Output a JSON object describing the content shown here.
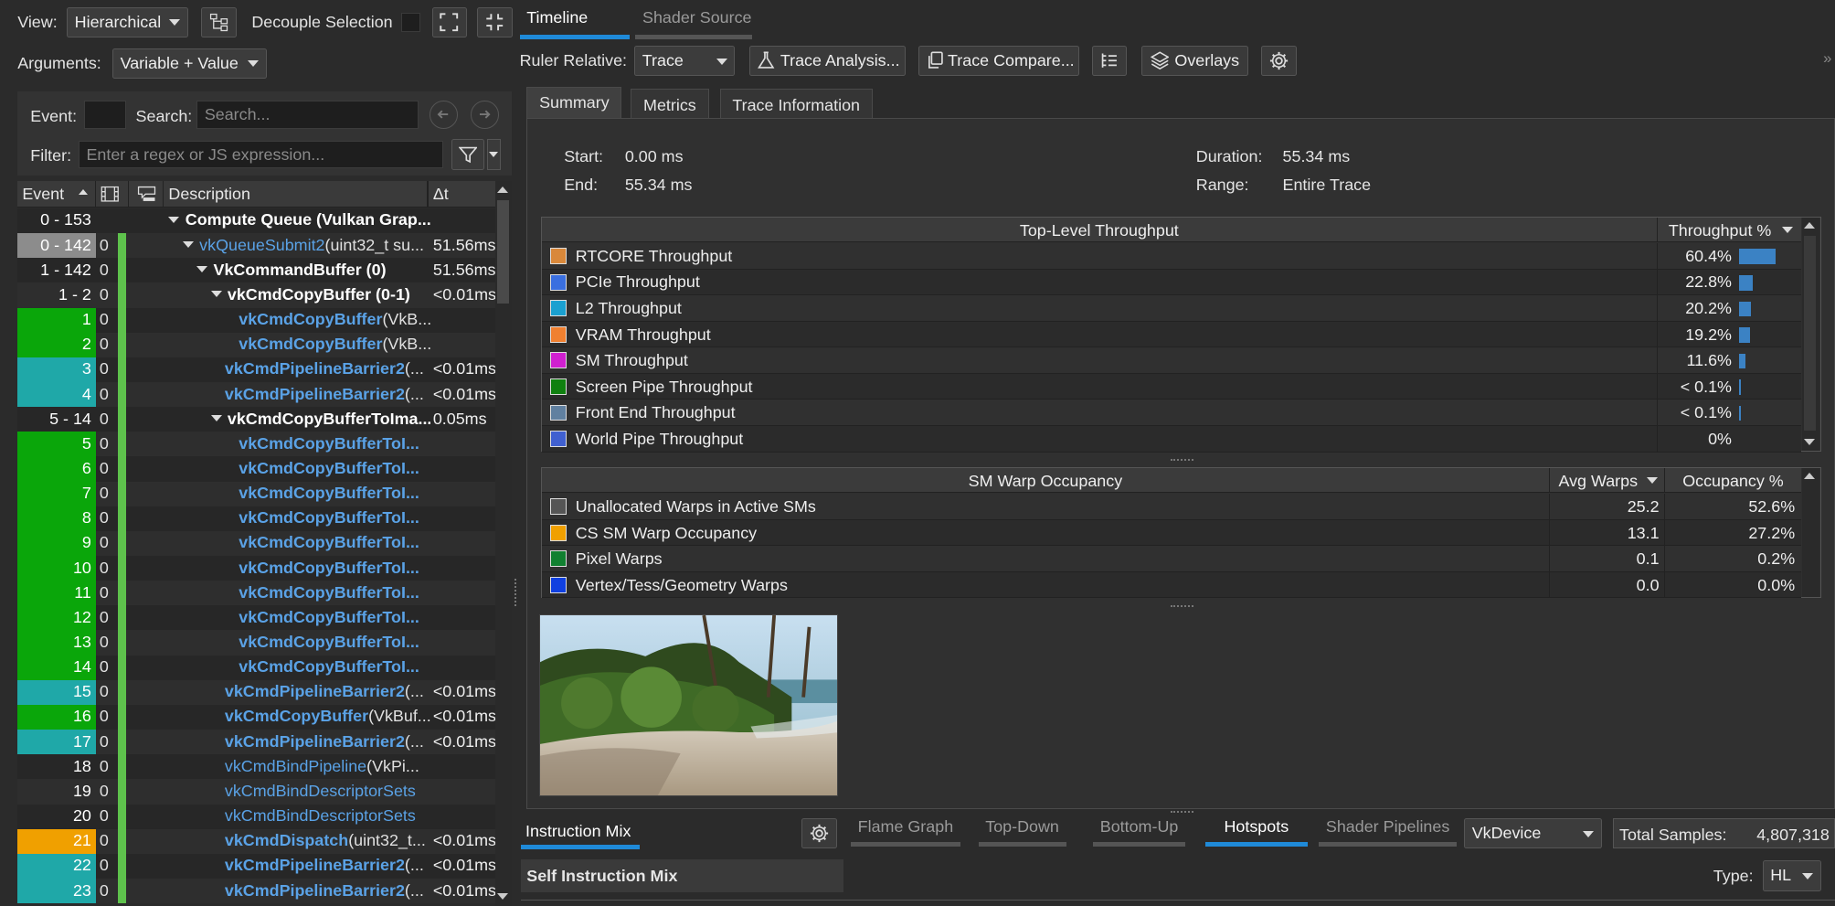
{
  "toolbar": {
    "view_label": "View:",
    "view_value": "Hierarchical",
    "decouple_label": "Decouple Selection",
    "arguments_label": "Arguments:",
    "arguments_value": "Variable + Value"
  },
  "search": {
    "event_label": "Event:",
    "search_label": "Search:",
    "search_placeholder": "Search...",
    "filter_label": "Filter:",
    "filter_placeholder": "Enter a regex or JS expression..."
  },
  "tree": {
    "headers": {
      "event": "Event",
      "description": "Description",
      "delta": "Δt"
    },
    "rows": [
      {
        "event": "0 - 153",
        "zero": "",
        "name": "Compute Queue (Vulkan Grap...",
        "args": "",
        "dt": "",
        "indent": 0,
        "style": "bold",
        "tri": true,
        "color": "",
        "bar": false
      },
      {
        "event": "0 - 142",
        "zero": "0",
        "name": "vkQueueSubmit2",
        "args": "(uint32_t su...",
        "dt": "51.56ms",
        "indent": 1,
        "style": "fnl",
        "tri": true,
        "color": "#8c8c8c",
        "bar": true
      },
      {
        "event": "1 - 142",
        "zero": "0",
        "name": "VkCommandBuffer (0)",
        "args": "",
        "dt": "51.56ms",
        "indent": 2,
        "style": "bold",
        "tri": true,
        "color": "",
        "bar": true
      },
      {
        "event": "1 - 2",
        "zero": "0",
        "name": "vkCmdCopyBuffer (0-1)",
        "args": "",
        "dt": "<0.01ms",
        "indent": 3,
        "style": "bold",
        "tri": true,
        "color": "",
        "bar": true
      },
      {
        "event": "1",
        "zero": "0",
        "name": "vkCmdCopyBuffer",
        "args": "(VkB...",
        "dt": "",
        "indent": 4,
        "style": "fn",
        "tri": false,
        "color": "#0aa60a",
        "bar": true
      },
      {
        "event": "2",
        "zero": "0",
        "name": "vkCmdCopyBuffer",
        "args": "(VkB...",
        "dt": "",
        "indent": 4,
        "style": "fn",
        "tri": false,
        "color": "#0aa60a",
        "bar": true
      },
      {
        "event": "3",
        "zero": "0",
        "name": "vkCmdPipelineBarrier2",
        "args": "(...",
        "dt": "<0.01ms",
        "indent": 3,
        "style": "fn",
        "tri": false,
        "color": "#1fa8a8",
        "bar": true
      },
      {
        "event": "4",
        "zero": "0",
        "name": "vkCmdPipelineBarrier2",
        "args": "(...",
        "dt": "<0.01ms",
        "indent": 3,
        "style": "fn",
        "tri": false,
        "color": "#1fa8a8",
        "bar": true
      },
      {
        "event": "5 - 14",
        "zero": "0",
        "name": "vkCmdCopyBufferToIma...",
        "args": "",
        "dt": "0.05ms",
        "indent": 3,
        "style": "bold",
        "tri": true,
        "color": "",
        "bar": true
      },
      {
        "event": "5",
        "zero": "0",
        "name": "vkCmdCopyBufferToI...",
        "args": "",
        "dt": "",
        "indent": 4,
        "style": "fn",
        "tri": false,
        "color": "#0aa60a",
        "bar": true
      },
      {
        "event": "6",
        "zero": "0",
        "name": "vkCmdCopyBufferToI...",
        "args": "",
        "dt": "",
        "indent": 4,
        "style": "fn",
        "tri": false,
        "color": "#0aa60a",
        "bar": true
      },
      {
        "event": "7",
        "zero": "0",
        "name": "vkCmdCopyBufferToI...",
        "args": "",
        "dt": "",
        "indent": 4,
        "style": "fn",
        "tri": false,
        "color": "#0aa60a",
        "bar": true
      },
      {
        "event": "8",
        "zero": "0",
        "name": "vkCmdCopyBufferToI...",
        "args": "",
        "dt": "",
        "indent": 4,
        "style": "fn",
        "tri": false,
        "color": "#0aa60a",
        "bar": true
      },
      {
        "event": "9",
        "zero": "0",
        "name": "vkCmdCopyBufferToI...",
        "args": "",
        "dt": "",
        "indent": 4,
        "style": "fn",
        "tri": false,
        "color": "#0aa60a",
        "bar": true
      },
      {
        "event": "10",
        "zero": "0",
        "name": "vkCmdCopyBufferToI...",
        "args": "",
        "dt": "",
        "indent": 4,
        "style": "fn",
        "tri": false,
        "color": "#0aa60a",
        "bar": true
      },
      {
        "event": "11",
        "zero": "0",
        "name": "vkCmdCopyBufferToI...",
        "args": "",
        "dt": "",
        "indent": 4,
        "style": "fn",
        "tri": false,
        "color": "#0aa60a",
        "bar": true
      },
      {
        "event": "12",
        "zero": "0",
        "name": "vkCmdCopyBufferToI...",
        "args": "",
        "dt": "",
        "indent": 4,
        "style": "fn",
        "tri": false,
        "color": "#0aa60a",
        "bar": true
      },
      {
        "event": "13",
        "zero": "0",
        "name": "vkCmdCopyBufferToI...",
        "args": "",
        "dt": "",
        "indent": 4,
        "style": "fn",
        "tri": false,
        "color": "#0aa60a",
        "bar": true
      },
      {
        "event": "14",
        "zero": "0",
        "name": "vkCmdCopyBufferToI...",
        "args": "",
        "dt": "",
        "indent": 4,
        "style": "fn",
        "tri": false,
        "color": "#0aa60a",
        "bar": true
      },
      {
        "event": "15",
        "zero": "0",
        "name": "vkCmdPipelineBarrier2",
        "args": "(...",
        "dt": "<0.01ms",
        "indent": 3,
        "style": "fn",
        "tri": false,
        "color": "#1fa8a8",
        "bar": true
      },
      {
        "event": "16",
        "zero": "0",
        "name": "vkCmdCopyBuffer",
        "args": "(VkBuf...",
        "dt": "<0.01ms",
        "indent": 3,
        "style": "fn",
        "tri": false,
        "color": "#0aa60a",
        "bar": true
      },
      {
        "event": "17",
        "zero": "0",
        "name": "vkCmdPipelineBarrier2",
        "args": "(...",
        "dt": "<0.01ms",
        "indent": 3,
        "style": "fn",
        "tri": false,
        "color": "#1fa8a8",
        "bar": true
      },
      {
        "event": "18",
        "zero": "0",
        "name": "vkCmdBindPipeline",
        "args": "(VkPi...",
        "dt": "",
        "indent": 3,
        "style": "fnl",
        "tri": false,
        "color": "",
        "bar": true
      },
      {
        "event": "19",
        "zero": "0",
        "name": "vkCmdBindDescriptorSets",
        "args": "",
        "dt": "",
        "indent": 3,
        "style": "fnl",
        "tri": false,
        "color": "",
        "bar": true
      },
      {
        "event": "20",
        "zero": "0",
        "name": "vkCmdBindDescriptorSets",
        "args": "",
        "dt": "",
        "indent": 3,
        "style": "fnl",
        "tri": false,
        "color": "",
        "bar": true
      },
      {
        "event": "21",
        "zero": "0",
        "name": "vkCmdDispatch",
        "args": "(uint32_t...",
        "dt": "<0.01ms",
        "indent": 3,
        "style": "fn",
        "tri": false,
        "color": "#f0a000",
        "bar": true
      },
      {
        "event": "22",
        "zero": "0",
        "name": "vkCmdPipelineBarrier2",
        "args": "(...",
        "dt": "<0.01ms",
        "indent": 3,
        "style": "fn",
        "tri": false,
        "color": "#1fa8a8",
        "bar": true
      },
      {
        "event": "23",
        "zero": "0",
        "name": "vkCmdPipelineBarrier2",
        "args": "(...",
        "dt": "<0.01ms",
        "indent": 3,
        "style": "fn",
        "tri": false,
        "color": "#1fa8a8",
        "bar": true
      }
    ]
  },
  "top_tabs": {
    "timeline": "Timeline",
    "shader_source": "Shader Source"
  },
  "ruler": {
    "label": "Ruler Relative:",
    "value": "Trace",
    "trace_analysis": "Trace Analysis...",
    "trace_compare": "Trace Compare...",
    "overlays": "Overlays"
  },
  "panel_tabs": {
    "summary": "Summary",
    "metrics": "Metrics",
    "trace_info": "Trace Information"
  },
  "summary": {
    "start_label": "Start:",
    "start_value": "0.00 ms",
    "end_label": "End:",
    "end_value": "55.34 ms",
    "duration_label": "Duration:",
    "duration_value": "55.34 ms",
    "range_label": "Range:",
    "range_value": "Entire Trace"
  },
  "throughput": {
    "header": "Top-Level Throughput",
    "value_header": "Throughput %",
    "rows": [
      {
        "name": "RTCORE Throughput",
        "value": "60.4%",
        "pct": 60.4,
        "color": "#d9883a"
      },
      {
        "name": "PCIe Throughput",
        "value": "22.8%",
        "pct": 22.8,
        "color": "#3a6fe0"
      },
      {
        "name": "L2 Throughput",
        "value": "20.2%",
        "pct": 20.2,
        "color": "#1aa0d0"
      },
      {
        "name": "VRAM Throughput",
        "value": "19.2%",
        "pct": 19.2,
        "color": "#f08030"
      },
      {
        "name": "SM Throughput",
        "value": "11.6%",
        "pct": 11.6,
        "color": "#d020d0"
      },
      {
        "name": "Screen Pipe Throughput",
        "value": "< 0.1%",
        "pct": 0.1,
        "color": "#108010"
      },
      {
        "name": "Front End Throughput",
        "value": "< 0.1%",
        "pct": 0.1,
        "color": "#6080a0"
      },
      {
        "name": "World Pipe Throughput",
        "value": "0%",
        "pct": 0,
        "color": "#4060d0"
      }
    ]
  },
  "warps": {
    "header": "SM Warp Occupancy",
    "avg_header": "Avg Warps",
    "occ_header": "Occupancy %",
    "rows": [
      {
        "name": "Unallocated Warps in Active SMs",
        "avg": "25.2",
        "occ": "52.6%",
        "color": "#555555"
      },
      {
        "name": "CS SM Warp Occupancy",
        "avg": "13.1",
        "occ": "27.2%",
        "color": "#f0a000"
      },
      {
        "name": "Pixel Warps",
        "avg": "0.1",
        "occ": "0.2%",
        "color": "#108030"
      },
      {
        "name": "Vertex/Tess/Geometry Warps",
        "avg": "0.0",
        "occ": "0.0%",
        "color": "#1040e0"
      }
    ]
  },
  "bottom": {
    "instruction_mix": "Instruction Mix",
    "flame_graph": "Flame Graph",
    "top_down": "Top-Down",
    "bottom_up": "Bottom-Up",
    "hotspots": "Hotspots",
    "shader_pipelines": "Shader Pipelines",
    "device_value": "VkDevice",
    "total_samples_label": "Total Samples:",
    "total_samples_value": "4,807,318",
    "self_instruction_mix": "Self Instruction Mix",
    "type_label": "Type:",
    "type_value": "HL"
  },
  "colors": {
    "accent": "#1f8ad8",
    "green_bar": "#5ec24c"
  }
}
